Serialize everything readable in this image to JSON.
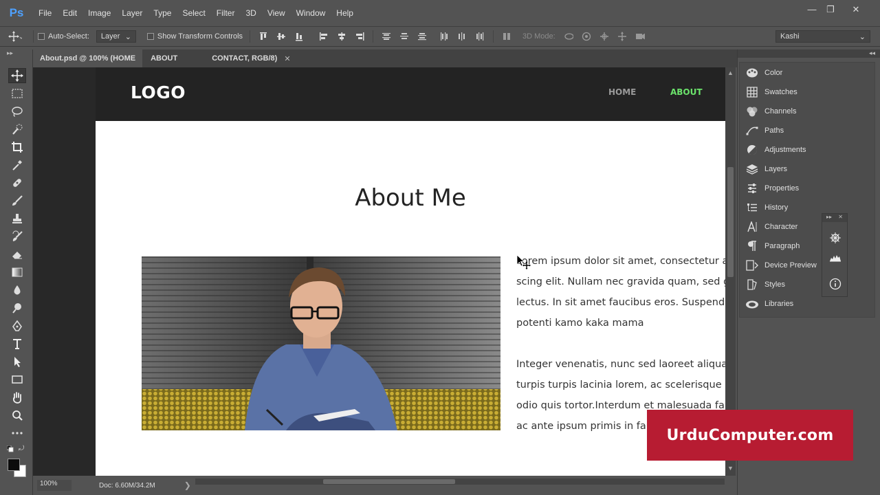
{
  "app": {
    "logo": "Ps"
  },
  "menu": [
    "File",
    "Edit",
    "Image",
    "Layer",
    "Type",
    "Select",
    "Filter",
    "3D",
    "View",
    "Window",
    "Help"
  ],
  "window_controls": {
    "minimize": "—",
    "restore": "❐",
    "close": "✕"
  },
  "options_bar": {
    "auto_select_label": "Auto-Select:",
    "auto_select_value": "Layer",
    "transform_label": "Show Transform Controls",
    "mode_3d_label": "3D Mode:",
    "workspace": "Kashi"
  },
  "tabs": [
    {
      "label": "About.psd @ 100% (HOME",
      "close": ""
    },
    {
      "label": "ABOUT",
      "close": ""
    },
    {
      "label": "CONTACT, RGB/8)",
      "close": "✕"
    }
  ],
  "website": {
    "logo": "LOGO",
    "nav": [
      {
        "label": "HOME",
        "color": "#9a9a9a"
      },
      {
        "label": "ABOUT",
        "color": "#6be36b"
      }
    ],
    "title": "About Me",
    "paragraph1": [
      "Lorem ipsum dolor sit amet, consectetur a",
      "scing elit. Nullam nec gravida quam, sed gr",
      "lectus. In sit amet faucibus eros. Suspendis",
      "potenti kamo kaka mama"
    ],
    "paragraph2": [
      "Integer venenatis, nunc sed laoreet aliquar",
      "turpis turpis lacinia lorem, ac scelerisque li",
      "odio quis tortor.Interdum et malesuada fa",
      "ac ante ipsum primis in fau"
    ]
  },
  "status": {
    "zoom": "100%",
    "doc": "Doc: 6.60M/34.2M",
    "arrow": "❯"
  },
  "panels": [
    "Color",
    "Swatches",
    "Channels",
    "Paths",
    "Adjustments",
    "Layers",
    "Properties",
    "History",
    "Character",
    "Paragraph",
    "Device Preview",
    "Styles",
    "Libraries"
  ],
  "watermark": "UrduComputer.com",
  "colors": {
    "accent_nav": "#6be36b",
    "watermark_bg": "#b71c32",
    "ps_blue": "#4ea1ff"
  }
}
